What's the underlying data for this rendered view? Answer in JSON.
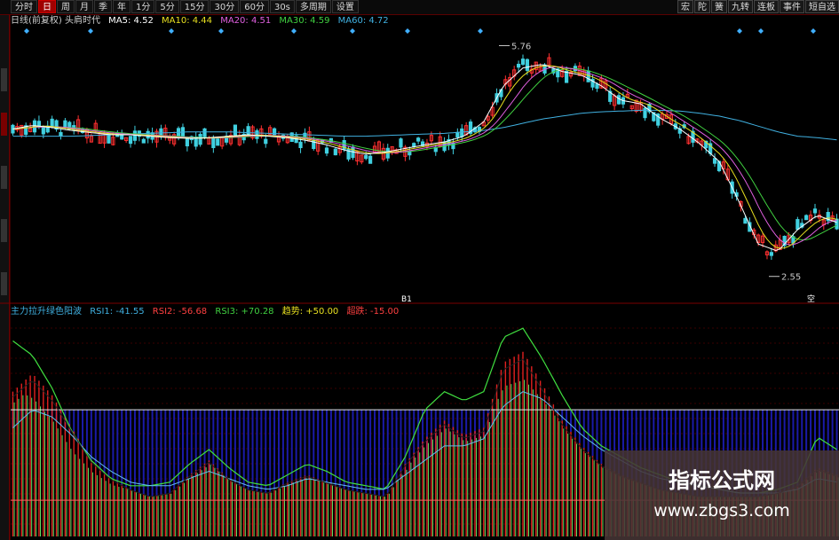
{
  "toolbar": {
    "periods": [
      "分时",
      "日",
      "周",
      "月",
      "季",
      "年",
      "1分",
      "5分",
      "15分",
      "30分",
      "60分",
      "30s",
      "多周期",
      "设置"
    ],
    "active_period": "日",
    "right_buttons": [
      "宏",
      "陀",
      "簧",
      "九转",
      "连板",
      "事件",
      "短自选"
    ]
  },
  "price_legend": {
    "title": "日线(前复权) 头肩时代",
    "items": [
      {
        "label": "MA5: 4.52",
        "color": "#ffffff"
      },
      {
        "label": "MA10: 4.44",
        "color": "#e8e020"
      },
      {
        "label": "MA20: 4.51",
        "color": "#e060e0"
      },
      {
        "label": "MA30: 4.59",
        "color": "#40d040"
      },
      {
        "label": "MA60: 4.72",
        "color": "#40b0e0"
      }
    ]
  },
  "indicator_legend": {
    "title": "主力拉升绿色阳波",
    "items": [
      {
        "label": "RSI1: -41.55",
        "color": "#40b0e0"
      },
      {
        "label": "RSI2: -56.68",
        "color": "#ff4040"
      },
      {
        "label": "RSI3: +70.28",
        "color": "#40d040"
      },
      {
        "label": "趋势: +50.00",
        "color": "#e8e020"
      },
      {
        "label": "超跌: -15.00",
        "color": "#ff4040"
      }
    ]
  },
  "price_annotations": {
    "high": "5.76",
    "low": "2.55"
  },
  "markers": {
    "left": "B1",
    "right": "空"
  },
  "chart_data": [
    {
      "type": "line",
      "title": "日线(前复权) 头肩时代",
      "series": [
        {
          "name": "MA5",
          "values": [
            4.6,
            4.65,
            4.62,
            4.58,
            4.55,
            4.52,
            4.52,
            4.5,
            4.48,
            4.47,
            4.48,
            4.5,
            4.52,
            4.5,
            4.48,
            4.44,
            4.38,
            4.3,
            4.25,
            4.28,
            4.33,
            4.38,
            4.42,
            4.5,
            4.7,
            5.2,
            5.45,
            5.5,
            5.4,
            5.35,
            5.2,
            5.0,
            4.95,
            4.75,
            4.6,
            4.4,
            4.15,
            3.6,
            3.0,
            2.9,
            3.2,
            3.4,
            3.3
          ]
        },
        {
          "name": "MA60",
          "values": [
            4.5,
            4.5,
            4.5,
            4.5,
            4.51,
            4.52,
            4.53,
            4.54,
            4.55,
            4.56,
            4.56,
            4.56,
            4.55,
            4.54,
            4.53,
            4.52,
            4.51,
            4.5,
            4.5,
            4.51,
            4.52,
            4.53,
            4.54,
            4.56,
            4.58,
            4.62,
            4.68,
            4.74,
            4.78,
            4.82,
            4.84,
            4.85,
            4.86,
            4.86,
            4.85,
            4.82,
            4.78,
            4.72,
            4.64,
            4.56,
            4.5,
            4.48,
            4.45
          ]
        }
      ],
      "annotations": [
        "5.76",
        "2.55"
      ]
    },
    {
      "type": "line",
      "title": "主力拉升绿色阳波",
      "series": [
        {
          "name": "RSI3",
          "values": [
            88,
            80,
            62,
            38,
            22,
            12,
            8,
            8,
            10,
            20,
            28,
            18,
            10,
            8,
            14,
            20,
            16,
            10,
            8,
            6,
            24,
            50,
            60,
            55,
            60,
            90,
            95,
            78,
            58,
            40,
            30,
            24,
            18,
            14,
            10,
            8,
            6,
            4,
            4,
            6,
            10,
            35,
            28
          ]
        },
        {
          "name": "RSI2",
          "values": [
            60,
            70,
            58,
            40,
            22,
            12,
            6,
            2,
            4,
            14,
            22,
            12,
            6,
            4,
            10,
            14,
            10,
            6,
            4,
            2,
            20,
            34,
            44,
            36,
            40,
            76,
            82,
            64,
            44,
            30,
            20,
            14,
            10,
            6,
            4,
            2,
            2,
            2,
            2,
            4,
            8,
            18,
            14
          ]
        },
        {
          "name": "RSI1",
          "values": [
            40,
            50,
            46,
            36,
            24,
            16,
            10,
            8,
            8,
            12,
            16,
            12,
            8,
            6,
            8,
            12,
            10,
            8,
            6,
            6,
            14,
            22,
            30,
            30,
            34,
            52,
            60,
            56,
            46,
            36,
            28,
            22,
            16,
            12,
            10,
            8,
            6,
            4,
            4,
            4,
            6,
            12,
            10
          ]
        }
      ],
      "reference_lines": [
        {
          "name": "趋势",
          "value": 50
        },
        {
          "name": "超跌",
          "value": -15
        }
      ]
    }
  ],
  "watermark": {
    "title": "指标公式网",
    "url": "www.zbgs3.com"
  }
}
